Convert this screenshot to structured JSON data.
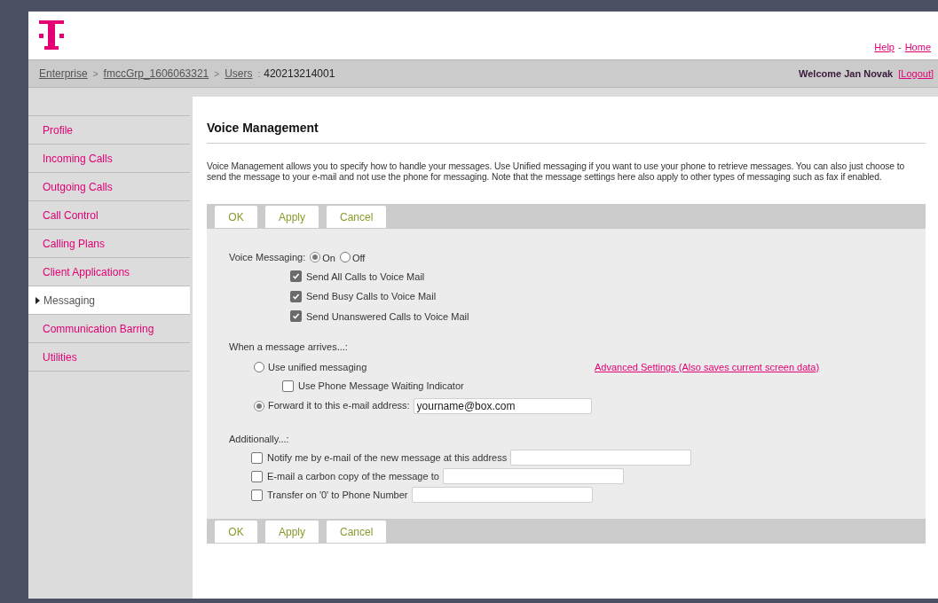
{
  "header": {
    "links": [
      {
        "label": "Help"
      },
      {
        "label": "Home"
      }
    ],
    "separator": "-"
  },
  "breadcrumb": [
    {
      "text": "Enterprise",
      "kind": "link"
    },
    {
      "text": ">",
      "kind": "separator"
    },
    {
      "text": "fmccGrp_1606063321",
      "kind": "link"
    },
    {
      "text": ">",
      "kind": "separator"
    },
    {
      "text": "Users",
      "kind": "link"
    },
    {
      "text": ":",
      "kind": "separator"
    },
    {
      "text": "420213214001",
      "kind": "current"
    }
  ],
  "welcome": "Welcome Jan Novak",
  "logout": "[Logout]",
  "sidebar": {
    "items": [
      {
        "label": "Profile",
        "selected": false
      },
      {
        "label": "Incoming Calls",
        "selected": false
      },
      {
        "label": "Outgoing Calls",
        "selected": false
      },
      {
        "label": "Call Control",
        "selected": false
      },
      {
        "label": "Calling Plans",
        "selected": false
      },
      {
        "label": "Client Applications",
        "selected": false
      },
      {
        "label": "Messaging",
        "selected": true
      },
      {
        "label": "Communication Barring",
        "selected": false
      },
      {
        "label": "Utilities",
        "selected": false
      }
    ]
  },
  "page_title": "Voice Management",
  "description": "Voice Management allows you to specify how to handle your messages. Use Unified messaging if you want to use your phone to retrieve messages. You can also just choose to send the message to your e-mail and not use the phone for messaging. Note that the message settings here also apply to other types of messaging such as fax if enabled.",
  "top_buttons": [
    "OK",
    "Apply",
    "Cancel"
  ],
  "voice_messaging": {
    "label": "Voice Messaging:",
    "options": [
      {
        "label": "On",
        "selected": true
      },
      {
        "label": "Off",
        "selected": false
      }
    ],
    "items": [
      {
        "label": "Send All Calls to Voice Mail",
        "checked": true
      },
      {
        "label": "Send Busy Calls to Voice Mail",
        "checked": true
      },
      {
        "label": "Send Unanswered Calls to Voice Mail",
        "checked": true
      }
    ]
  },
  "message_arrives": {
    "label": "When a message arrives...:",
    "link": "Advanced Settings (Also saves current screen data)",
    "options": [
      {
        "label": "Use unified messaging",
        "selected": false,
        "children": [
          {
            "label": "Use Phone Message Waiting Indicator",
            "checked": false
          }
        ]
      },
      {
        "label": "Forward it to this e-mail address:",
        "selected": true,
        "value": "yourname@box.com"
      }
    ]
  },
  "additionally": {
    "label": "Additionally...:",
    "items": [
      {
        "label": "Notify me by e-mail of the new message at this address",
        "checked": false
      },
      {
        "label": "E-mail a carbon copy of the message to",
        "checked": false
      },
      {
        "label": "Transfer on '0' to Phone Number",
        "checked": false
      }
    ]
  },
  "bottom_buttons": [
    "OK",
    "Apply",
    "Cancel"
  ]
}
